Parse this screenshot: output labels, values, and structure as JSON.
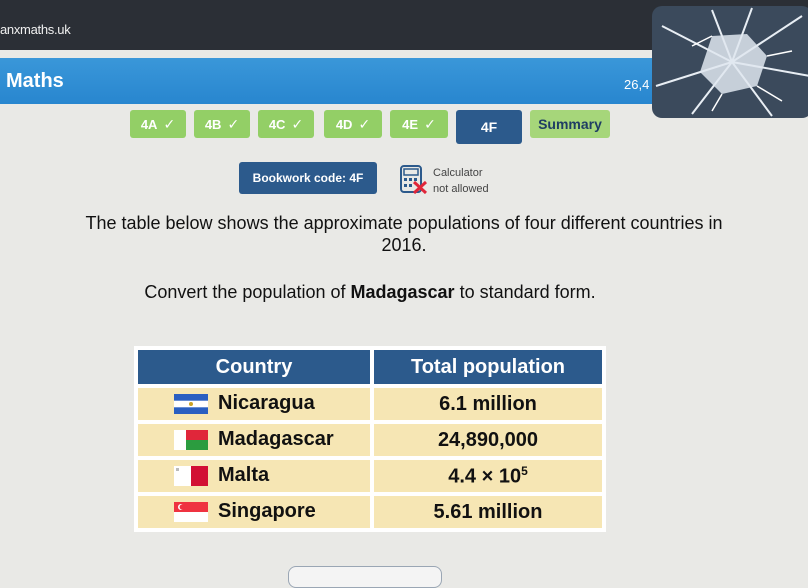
{
  "browser": {
    "url": "anxmaths.uk"
  },
  "header": {
    "title": "Maths",
    "score": "26,4"
  },
  "tabs": [
    {
      "label": "4A",
      "check": "✓"
    },
    {
      "label": "4B",
      "check": "✓"
    },
    {
      "label": "4C",
      "check": "✓"
    },
    {
      "label": "4D",
      "check": "✓"
    },
    {
      "label": "4E",
      "check": "✓"
    },
    {
      "label": "4F"
    },
    {
      "label": "Summary"
    }
  ],
  "bookwork": {
    "label": "Bookwork code: 4F"
  },
  "calculator": {
    "line1": "Calculator",
    "line2": "not allowed"
  },
  "question": {
    "line1": "The table below shows the approximate populations of four different countries in",
    "line2": "2016.",
    "instruction_pre": "Convert the population of ",
    "instruction_bold": "Madagascar",
    "instruction_post": " to standard form."
  },
  "table": {
    "headers": [
      "Country",
      "Total population"
    ],
    "rows": [
      {
        "country": "Nicaragua",
        "population": "6.1 million"
      },
      {
        "country": "Madagascar",
        "population": "24,890,000"
      },
      {
        "country": "Malta",
        "population_base": "4.4 × 10",
        "population_exp": "5"
      },
      {
        "country": "Singapore",
        "population": "5.61 million"
      }
    ]
  },
  "colors": {
    "tab_done": "#93cf66",
    "tab_active": "#2c5a8c",
    "header_blue": "#3a97d9",
    "table_cell": "#f6e6b4"
  }
}
